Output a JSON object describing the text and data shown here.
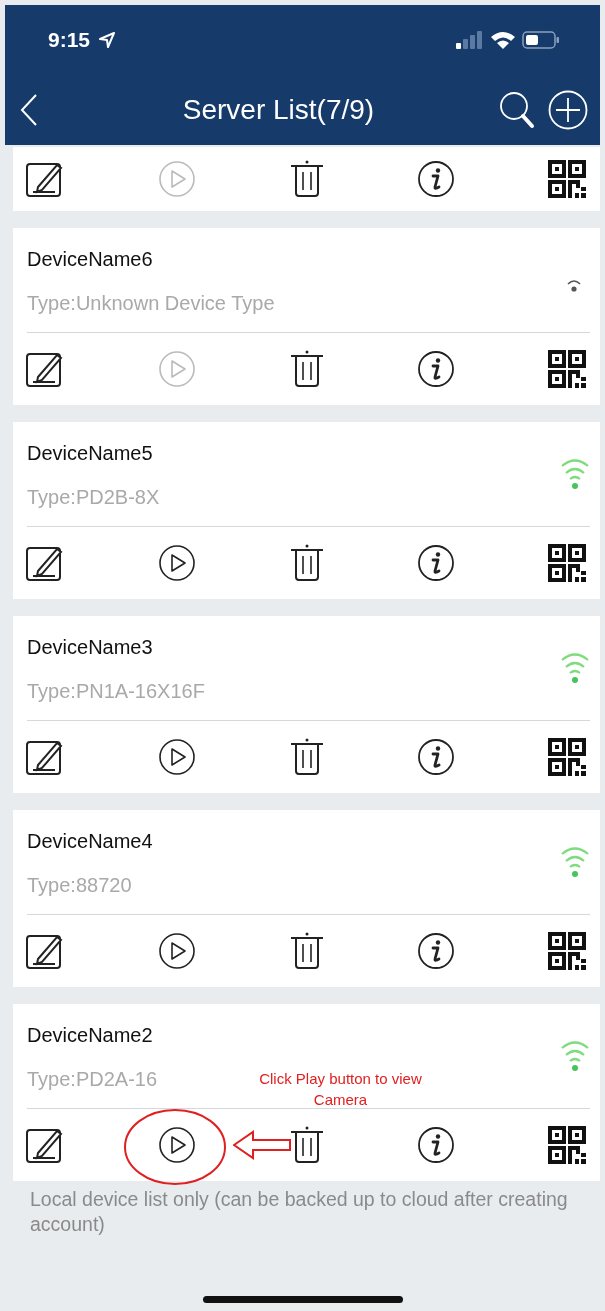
{
  "status_bar": {
    "time": "9:15"
  },
  "nav": {
    "title": "Server List(7/9)"
  },
  "top_card": {
    "playable": false
  },
  "devices": [
    {
      "name": "DeviceName6",
      "type": "Type:Unknown Device Type",
      "online": false,
      "playable": false
    },
    {
      "name": "DeviceName5",
      "type": "Type:PD2B-8X",
      "online": true,
      "playable": true
    },
    {
      "name": "DeviceName3",
      "type": "Type:PN1A-16X16F",
      "online": true,
      "playable": true
    },
    {
      "name": "DeviceName4",
      "type": "Type:88720",
      "online": true,
      "playable": true
    },
    {
      "name": "DeviceName2",
      "type": "Type:PD2A-16",
      "online": true,
      "playable": true,
      "annotation": "Click Play button to view Camera"
    }
  ],
  "footer": "Local device list only (can be backed up to cloud after creating account)"
}
